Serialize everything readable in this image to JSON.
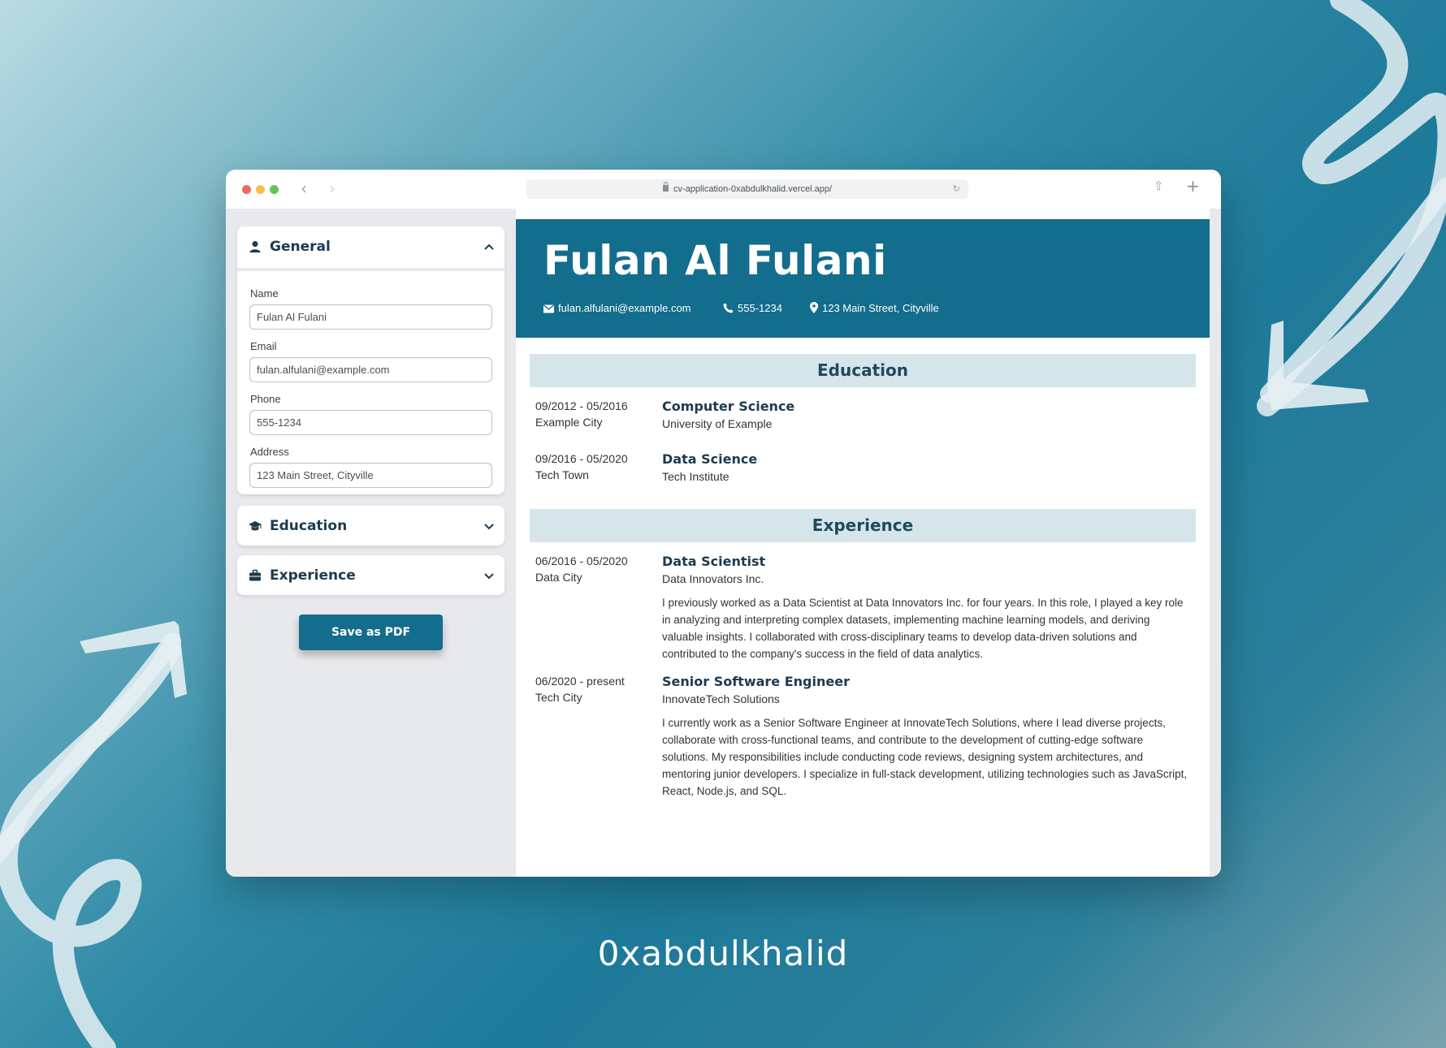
{
  "browser": {
    "url": "cv-application-0xabdulkhalid.vercel.app/"
  },
  "sidebar": {
    "general": {
      "title": "General",
      "fields": {
        "name": {
          "label": "Name",
          "value": "Fulan Al Fulani"
        },
        "email": {
          "label": "Email",
          "value": "fulan.alfulani@example.com"
        },
        "phone": {
          "label": "Phone",
          "value": "555-1234"
        },
        "address": {
          "label": "Address",
          "value": "123 Main Street, Cityville"
        }
      }
    },
    "education": {
      "title": "Education"
    },
    "experience": {
      "title": "Experience"
    },
    "save_label": "Save as PDF"
  },
  "resume": {
    "name": "Fulan Al Fulani",
    "email": "fulan.alfulani@example.com",
    "phone": "555-1234",
    "address": "123 Main Street, Cityville",
    "education_heading": "Education",
    "education": [
      {
        "dates": "09/2012 - 05/2016",
        "location": "Example City",
        "title": "Computer Science",
        "org": "University of Example"
      },
      {
        "dates": "09/2016 - 05/2020",
        "location": "Tech Town",
        "title": "Data Science",
        "org": "Tech Institute"
      }
    ],
    "experience_heading": "Experience",
    "experience": [
      {
        "dates": "06/2016 - 05/2020",
        "location": "Data City",
        "title": "Data Scientist",
        "org": "Data Innovators Inc.",
        "description": "I previously worked as a Data Scientist at Data Innovators Inc. for four years. In this role, I played a key role in analyzing and interpreting complex datasets, implementing machine learning models, and deriving valuable insights. I collaborated with cross-disciplinary teams to develop data-driven solutions and contributed to the company's success in the field of data analytics."
      },
      {
        "dates": "06/2020 - present",
        "location": "Tech City",
        "title": "Senior Software Engineer",
        "org": "InnovateTech Solutions",
        "description": "I currently work as a Senior Software Engineer at InnovateTech Solutions, where I lead diverse projects, collaborate with cross-functional teams, and contribute to the development of cutting-edge software solutions. My responsibilities include conducting code reviews, designing system architectures, and mentoring junior developers. I specialize in full-stack development, utilizing technologies such as JavaScript, React, Node.js, and SQL."
      }
    ]
  },
  "footer": {
    "handle": "0xabdulkhalid"
  },
  "colors": {
    "accent": "#136d8c",
    "section_bg": "#d6e5ea",
    "sidebar_bg": "#e8e9ec"
  }
}
